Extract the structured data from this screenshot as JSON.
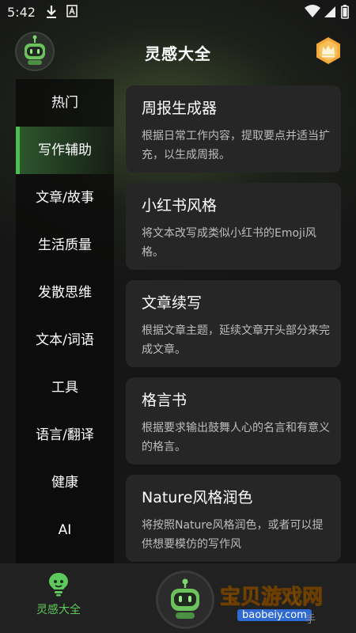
{
  "status_bar": {
    "time": "5:42"
  },
  "header": {
    "title": "灵感大全"
  },
  "sidebar": {
    "items": [
      {
        "label": "热门",
        "active": false
      },
      {
        "label": "写作辅助",
        "active": true
      },
      {
        "label": "文章/故事",
        "active": false
      },
      {
        "label": "生活质量",
        "active": false
      },
      {
        "label": "发散思维",
        "active": false
      },
      {
        "label": "文本/词语",
        "active": false
      },
      {
        "label": "工具",
        "active": false
      },
      {
        "label": "语言/翻译",
        "active": false
      },
      {
        "label": "健康",
        "active": false
      },
      {
        "label": "AI",
        "active": false
      }
    ]
  },
  "cards": [
    {
      "title": "周报生成器",
      "desc": "根据日常工作内容，提取要点并适当扩充，以生成周报。"
    },
    {
      "title": "小红书风格",
      "desc": "将文本改写成类似小红书的Emoji风格。"
    },
    {
      "title": "文章续写",
      "desc": "根据文章主题，延续文章开头部分来完成文章。"
    },
    {
      "title": "格言书",
      "desc": "根据要求输出鼓舞人心的名言和有意义的格言。"
    },
    {
      "title": "Nature风格润色",
      "desc": "将按照Nature风格润色，或者可以提供想要模仿的写作风"
    }
  ],
  "bottom_nav": {
    "home_label": "灵感大全"
  },
  "watermark": {
    "text": "宝贝游戏网",
    "domain": "baobeiy.com",
    "tail": "手"
  },
  "colors": {
    "accent": "#4cbe52",
    "background": "#161616",
    "card": "#262626"
  }
}
